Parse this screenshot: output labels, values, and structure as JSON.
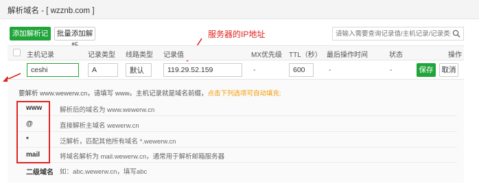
{
  "window": {
    "title": "解析域名 - [ wzznb.com ]"
  },
  "toolbar": {
    "add_record_label": "添加解析记录",
    "batch_add_label": "批量添加解析",
    "search_placeholder": "请输入需要查询记录值/主机记录/记录类型/TTL"
  },
  "annotation": {
    "server_ip_note": "服务器的IP地址"
  },
  "table": {
    "headers": {
      "host": "主机记录",
      "type": "记录类型",
      "line": "线路类型",
      "value": "记录值",
      "mx": "MX优先级",
      "ttl": "TTL（秒）",
      "last_op": "最后操作时间",
      "status": "状态",
      "actions": "操作"
    },
    "edit_row": {
      "host": "ceshi",
      "type": "A",
      "line": "默认",
      "value": "119.29.52.159",
      "mx": "-",
      "ttl": "600",
      "last_op": "-",
      "status": "-",
      "save_label": "保存",
      "cancel_label": "取消"
    }
  },
  "help": {
    "intro_text": "要解析 www.wewerw.cn，请填写 www。主机记录就是域名前缀，",
    "intro_link": "点击下列选项可自动填充:",
    "rows": [
      {
        "key": "www",
        "desc": "解析后的域名为 www.wewerw.cn"
      },
      {
        "key": "@",
        "desc": "直接解析主域名 wewerw.cn"
      },
      {
        "key": "*",
        "desc": "泛解析，匹配其他所有域名 *.wewerw.cn"
      },
      {
        "key": "mail",
        "desc": "将域名解析为 mail.wewerw.cn，通常用于解析邮箱服务器"
      },
      {
        "key": "二级域名",
        "desc": "如：abc.wewerw.cn，填写abc"
      }
    ]
  },
  "colors": {
    "accent": "#20a53a",
    "annotation": "#e02020",
    "link": "#f39800"
  }
}
